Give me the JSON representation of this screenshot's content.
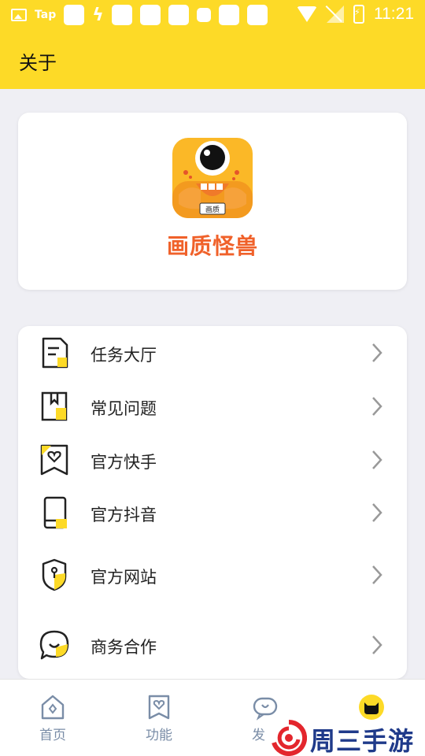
{
  "status_bar": {
    "carrier_label": "Tap",
    "time": "11:21",
    "icons": [
      "image-icon",
      "tap-icon",
      "notification-icon",
      "bolt-icon",
      "wifi-icon",
      "no-signal-icon",
      "battery-charging-icon"
    ]
  },
  "header": {
    "title": "关于"
  },
  "app": {
    "name": "画质怪兽",
    "logo_badge": "画质",
    "brand_color": "#f0612a",
    "accent_color": "#fdda27"
  },
  "menu": {
    "items": [
      {
        "label": "任务大厅",
        "icon": "task-doc-icon"
      },
      {
        "label": "常见问题",
        "icon": "faq-book-icon"
      },
      {
        "label": "官方快手",
        "icon": "kuaishou-heart-icon"
      },
      {
        "label": "官方抖音",
        "icon": "douyin-phone-icon"
      },
      {
        "label": "官方网站",
        "icon": "website-shield-icon"
      },
      {
        "label": "商务合作",
        "icon": "chat-bubble-icon"
      }
    ]
  },
  "tabbar": {
    "tabs": [
      {
        "label": "首页",
        "icon": "home-icon",
        "active": false
      },
      {
        "label": "功能",
        "icon": "feature-heart-icon",
        "active": false
      },
      {
        "label": "发",
        "icon": "discover-chat-icon",
        "active": false
      },
      {
        "label": "",
        "icon": "cat-face-icon",
        "active": true
      }
    ]
  },
  "watermark": {
    "text": "周三手游网"
  }
}
